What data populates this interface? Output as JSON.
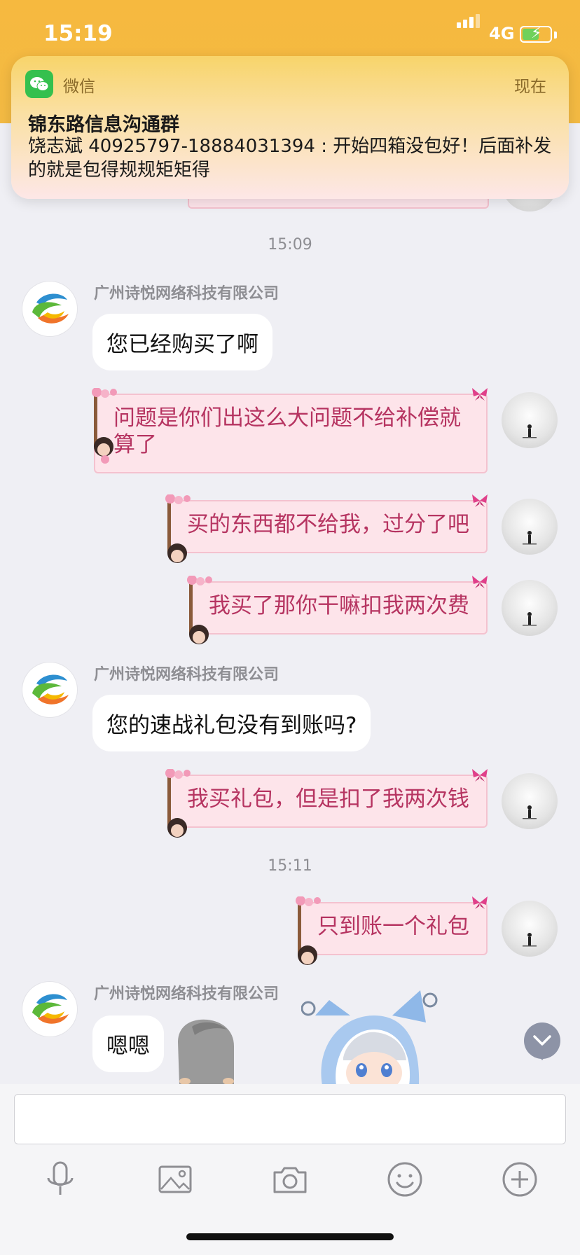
{
  "status_bar": {
    "time": "15:19",
    "network": "4G",
    "battery_level": 0.6,
    "charging": true
  },
  "notification": {
    "app_name": "微信",
    "time": "现在",
    "title": "锦东路信息沟通群",
    "body": "饶志斌 40925797-18884031394 : 开始四箱没包好！后面补发的就是包得规规矩矩得",
    "icon": "wechat-icon"
  },
  "chat": {
    "time_dividers": [
      "15:09",
      "15:11"
    ],
    "sender_name": "广州诗悦网络科技有限公司",
    "messages": [
      {
        "side": "left",
        "text": "您已经购买了啊"
      },
      {
        "side": "right",
        "text": "问题是你们出这么大问题不给补偿就算了"
      },
      {
        "side": "right",
        "text": "买的东西都不给我，过分了吧"
      },
      {
        "side": "right",
        "text": "我买了那你干嘛扣我两次费"
      },
      {
        "side": "left",
        "text": "您的速战礼包没有到账吗?"
      },
      {
        "side": "right",
        "text": "我买礼包，但是扣了我两次钱"
      },
      {
        "side": "right",
        "text": "只到账一个礼包"
      },
      {
        "side": "left",
        "text": "嗯嗯"
      }
    ]
  },
  "toolbar": {
    "icons": [
      "microphone-icon",
      "image-icon",
      "camera-icon",
      "emoji-icon",
      "plus-icon"
    ]
  },
  "colors": {
    "header": "#f6b93f",
    "bubble_self_bg": "#fde4ea",
    "bubble_self_text": "#b63461",
    "bubble_other_bg": "#ffffff",
    "background": "#efeff4"
  }
}
